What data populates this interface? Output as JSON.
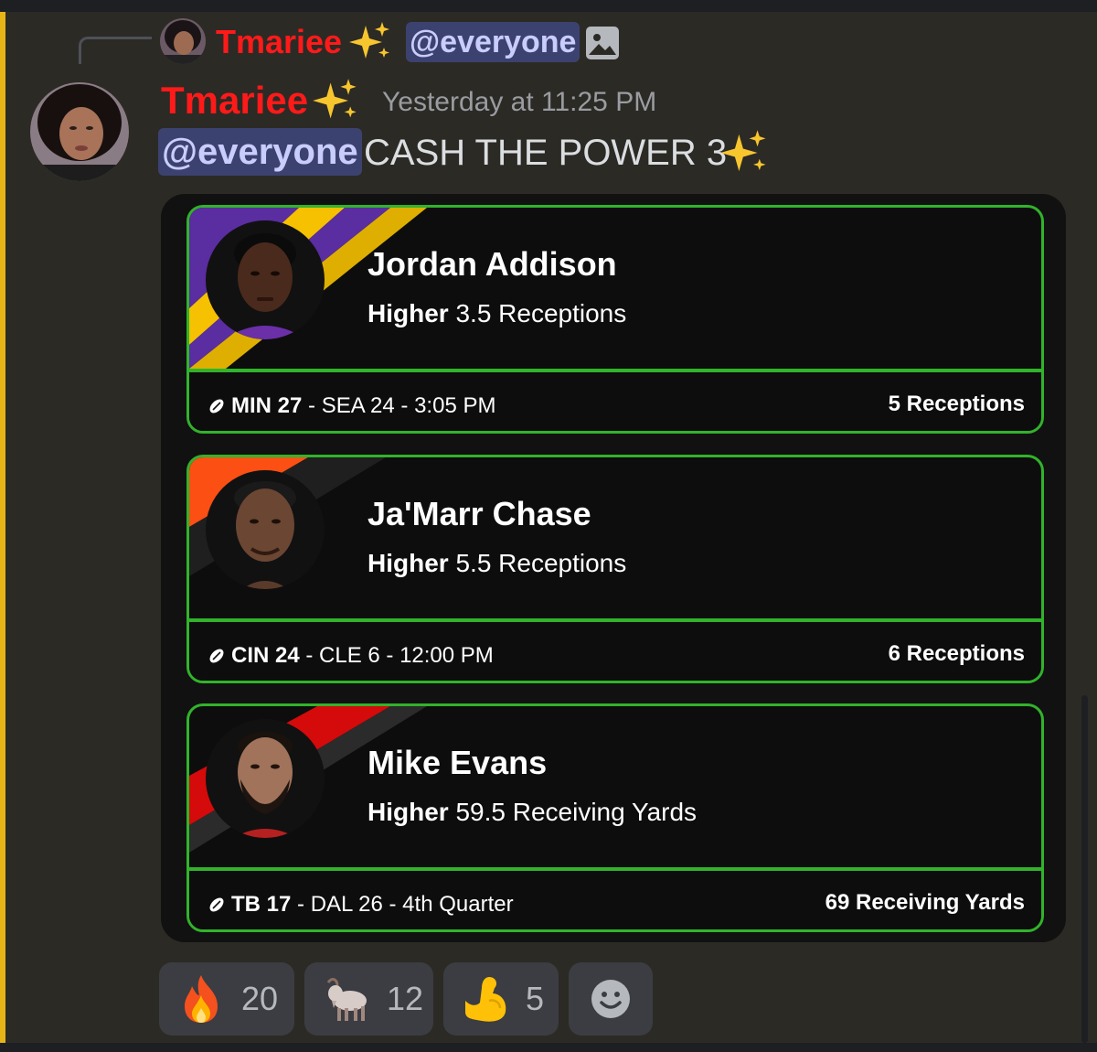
{
  "reply": {
    "author": "Tmariee",
    "mention": "@everyone"
  },
  "message": {
    "author": "Tmariee",
    "timestamp": "Yesterday at 11:25 PM",
    "mention": "@everyone",
    "text": "CASH THE POWER 3"
  },
  "picks": [
    {
      "player": "Jordan Addison",
      "direction": "Higher",
      "line": "3.5 Receptions",
      "team_score": "MIN 27",
      "rest": "- SEA 24 - 3:05 PM",
      "result": "5 Receptions",
      "stripe_colors": [
        "#5a2da0",
        "#f5c100"
      ]
    },
    {
      "player": "Ja'Marr Chase",
      "direction": "Higher",
      "line": "5.5 Receptions",
      "team_score": "CIN 24",
      "rest": "- CLE 6 - 12:00 PM",
      "result": "6 Receptions",
      "stripe_colors": [
        "#fb4f14",
        "#1a1a1a"
      ]
    },
    {
      "player": "Mike Evans",
      "direction": "Higher",
      "line": "59.5 Receiving Yards",
      "team_score": "TB 17",
      "rest": "- DAL 26 - 4th Quarter",
      "result": "69 Receiving Yards",
      "stripe_colors": [
        "#d50a0a",
        "#2b2b2b"
      ]
    }
  ],
  "reactions": [
    {
      "emoji": "fire-emoji",
      "count": "20"
    },
    {
      "emoji": "goat-emoji",
      "count": "12"
    },
    {
      "emoji": "flexed-biceps-emoji",
      "count": "5"
    }
  ],
  "colors": {
    "author": "#ff1a1a",
    "mention_bg": "#3c4270",
    "card_border": "#31b32b",
    "accent_bar": "#e6b417"
  }
}
